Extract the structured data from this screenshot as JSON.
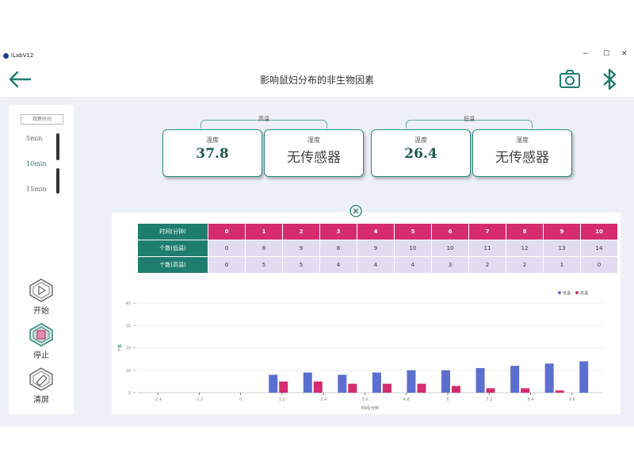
{
  "window": {
    "app_title": "iLabV12",
    "minimize": "−",
    "maximize": "☐",
    "close": "✕"
  },
  "header": {
    "title": "影响鼠妇分布的非生物因素"
  },
  "sidebar": {
    "interval_label": "观察时间",
    "intervals": [
      "5min",
      "10min",
      "15min"
    ],
    "selected_interval": "10min",
    "controls": [
      {
        "label": "开始",
        "icon": "play-icon"
      },
      {
        "label": "停止",
        "icon": "stop-icon"
      },
      {
        "label": "清屏",
        "icon": "clear-icon"
      }
    ]
  },
  "groups": [
    {
      "name": "高温",
      "sensors": [
        {
          "name": "温度",
          "value": "37.8"
        },
        {
          "name": "湿度",
          "value": "无传感器"
        }
      ]
    },
    {
      "name": "低温",
      "sensors": [
        {
          "name": "温度",
          "value": "26.4"
        },
        {
          "name": "湿度",
          "value": "无传感器"
        }
      ]
    }
  ],
  "table": {
    "header_label": "时间(分钟)",
    "times": [
      "0",
      "1",
      "2",
      "3",
      "4",
      "5",
      "6",
      "7",
      "8",
      "9",
      "10"
    ],
    "rows": [
      {
        "label": "个数(低温)",
        "values": [
          "0",
          "8",
          "9",
          "8",
          "9",
          "10",
          "10",
          "11",
          "12",
          "13",
          "14"
        ]
      },
      {
        "label": "个数(高温)",
        "values": [
          "0",
          "5",
          "5",
          "4",
          "4",
          "4",
          "3",
          "2",
          "2",
          "1",
          "0"
        ]
      }
    ]
  },
  "chart_data": {
    "type": "bar",
    "xlabel": "时间/分钟",
    "ylabel": "个数",
    "x_ticks": [
      "-2.4",
      "-1.2",
      "0",
      "1.2",
      "2.4",
      "3.6",
      "4.8",
      "6",
      "7.2",
      "8.4",
      "9.6"
    ],
    "x_range": [
      -3,
      10.5
    ],
    "y_ticks": [
      "0",
      "10",
      "20",
      "30",
      "40"
    ],
    "ylim": [
      0,
      40
    ],
    "x": [
      1,
      2,
      3,
      4,
      5,
      6,
      7,
      8,
      9,
      10
    ],
    "series": [
      {
        "name": "低温",
        "color": "#5b6fd0",
        "values": [
          8,
          9,
          8,
          9,
          10,
          10,
          11,
          12,
          13,
          14
        ]
      },
      {
        "name": "高温",
        "color": "#d42c6e",
        "values": [
          5,
          5,
          4,
          4,
          4,
          3,
          2,
          2,
          1,
          0
        ]
      }
    ],
    "legend": "top-right",
    "grid": true
  },
  "colors": {
    "accent": "#1f7d6f",
    "header_cell": "#d42c6e",
    "data_cell": "#e1dcf2"
  }
}
